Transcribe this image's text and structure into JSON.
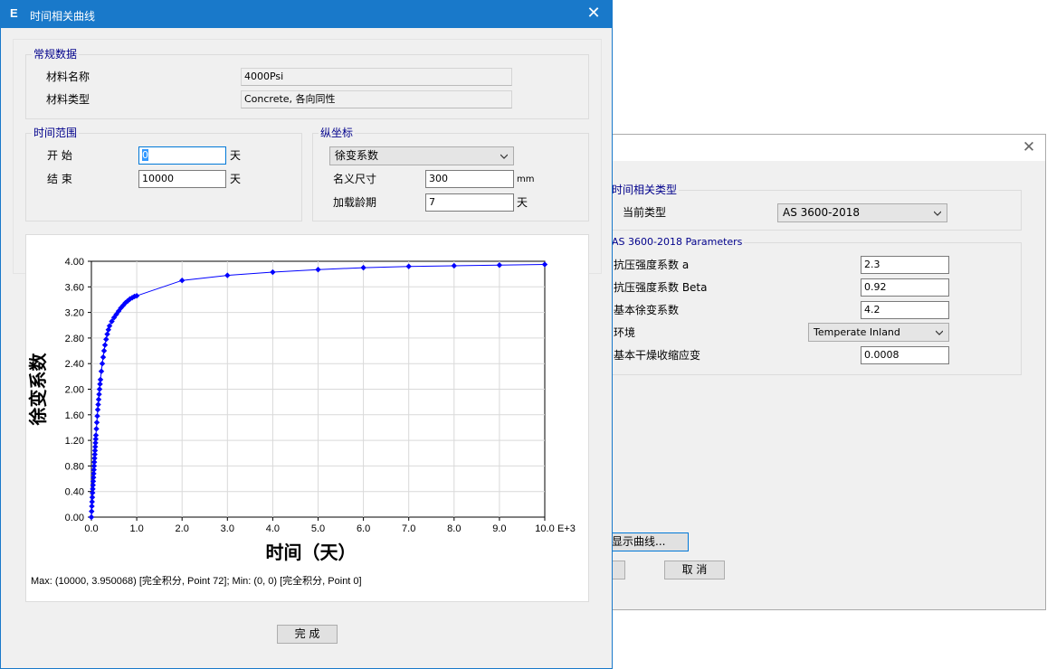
{
  "back_window": {
    "close_glyph": "✕",
    "type_group": {
      "label": "时间相关类型",
      "current_type_label": "当前类型",
      "current_type_value": "AS 3600-2018"
    },
    "params_group": {
      "label": "AS 3600-2018 Parameters",
      "rows": [
        {
          "label": "抗压强度系数 a",
          "value": "2.3"
        },
        {
          "label": "抗压强度系数 Beta",
          "value": "0.92"
        },
        {
          "label": "基本徐变系数",
          "value": "4.2"
        },
        {
          "label": "环境",
          "value": "Temperate Inland",
          "kind": "dropdown"
        },
        {
          "label": "基本干燥收缩应变",
          "value": "0.0008"
        }
      ]
    },
    "show_curve_button": "显示曲线...",
    "cancel_button": "取 消"
  },
  "front_window": {
    "title": "时间相关曲线",
    "icon_letter": "E",
    "close_glyph": "✕",
    "general": {
      "label": "常规数据",
      "material_name_label": "材料名称",
      "material_name_value": "4000Psi",
      "material_type_label": "材料类型",
      "material_type_value": "Concrete, 各向同性"
    },
    "time_range": {
      "label": "时间范围",
      "start_label": "开 始",
      "start_value": "0",
      "end_label": "结 束",
      "end_value": "10000",
      "unit": "天"
    },
    "ordinate": {
      "label": "纵坐标",
      "selected": "徐变系数",
      "nominal_size_label": "名义尺寸",
      "nominal_size_value": "300",
      "nominal_size_unit": "mm",
      "loading_age_label": "加载龄期",
      "loading_age_value": "7",
      "loading_age_unit": "天"
    },
    "chart_info": "Max: (10000, 3.950068)  [完全积分, Point 72];   Min: (0, 0)  [完全积分, Point 0]",
    "done_button": "完 成"
  },
  "chart_data": {
    "type": "scatter",
    "xlabel": "时间（天）",
    "ylabel": "徐变系数",
    "x_unit": "E+3",
    "xlim": [
      0,
      10000
    ],
    "ylim": [
      0,
      4.0
    ],
    "x_ticks": [
      "0.0",
      "1.0",
      "2.0",
      "3.0",
      "4.0",
      "5.0",
      "6.0",
      "7.0",
      "8.0",
      "9.0",
      "10.0"
    ],
    "y_ticks": [
      "0.00",
      "0.40",
      "0.80",
      "1.20",
      "1.60",
      "2.00",
      "2.40",
      "2.80",
      "3.20",
      "3.60",
      "4.00"
    ],
    "grid": true,
    "color": "#0000ff",
    "x": [
      0,
      5,
      10,
      15,
      20,
      25,
      30,
      35,
      40,
      45,
      50,
      55,
      60,
      65,
      70,
      75,
      80,
      85,
      90,
      95,
      100,
      110,
      120,
      130,
      140,
      150,
      160,
      170,
      180,
      190,
      200,
      220,
      240,
      260,
      280,
      300,
      325,
      350,
      375,
      400,
      450,
      500,
      550,
      600,
      650,
      700,
      750,
      800,
      850,
      900,
      950,
      1000,
      2000,
      3000,
      4000,
      5000,
      6000,
      7000,
      8000,
      9000,
      10000
    ],
    "y": [
      0.0,
      0.09,
      0.17,
      0.24,
      0.31,
      0.38,
      0.44,
      0.5,
      0.56,
      0.62,
      0.68,
      0.74,
      0.8,
      0.86,
      0.92,
      0.98,
      1.04,
      1.1,
      1.16,
      1.22,
      1.28,
      1.38,
      1.48,
      1.58,
      1.68,
      1.76,
      1.84,
      1.92,
      2.0,
      2.08,
      2.15,
      2.28,
      2.4,
      2.5,
      2.6,
      2.69,
      2.78,
      2.86,
      2.93,
      2.99,
      3.06,
      3.12,
      3.17,
      3.22,
      3.27,
      3.31,
      3.35,
      3.38,
      3.41,
      3.43,
      3.45,
      3.46,
      3.7,
      3.78,
      3.83,
      3.87,
      3.9,
      3.92,
      3.93,
      3.94,
      3.95
    ]
  }
}
